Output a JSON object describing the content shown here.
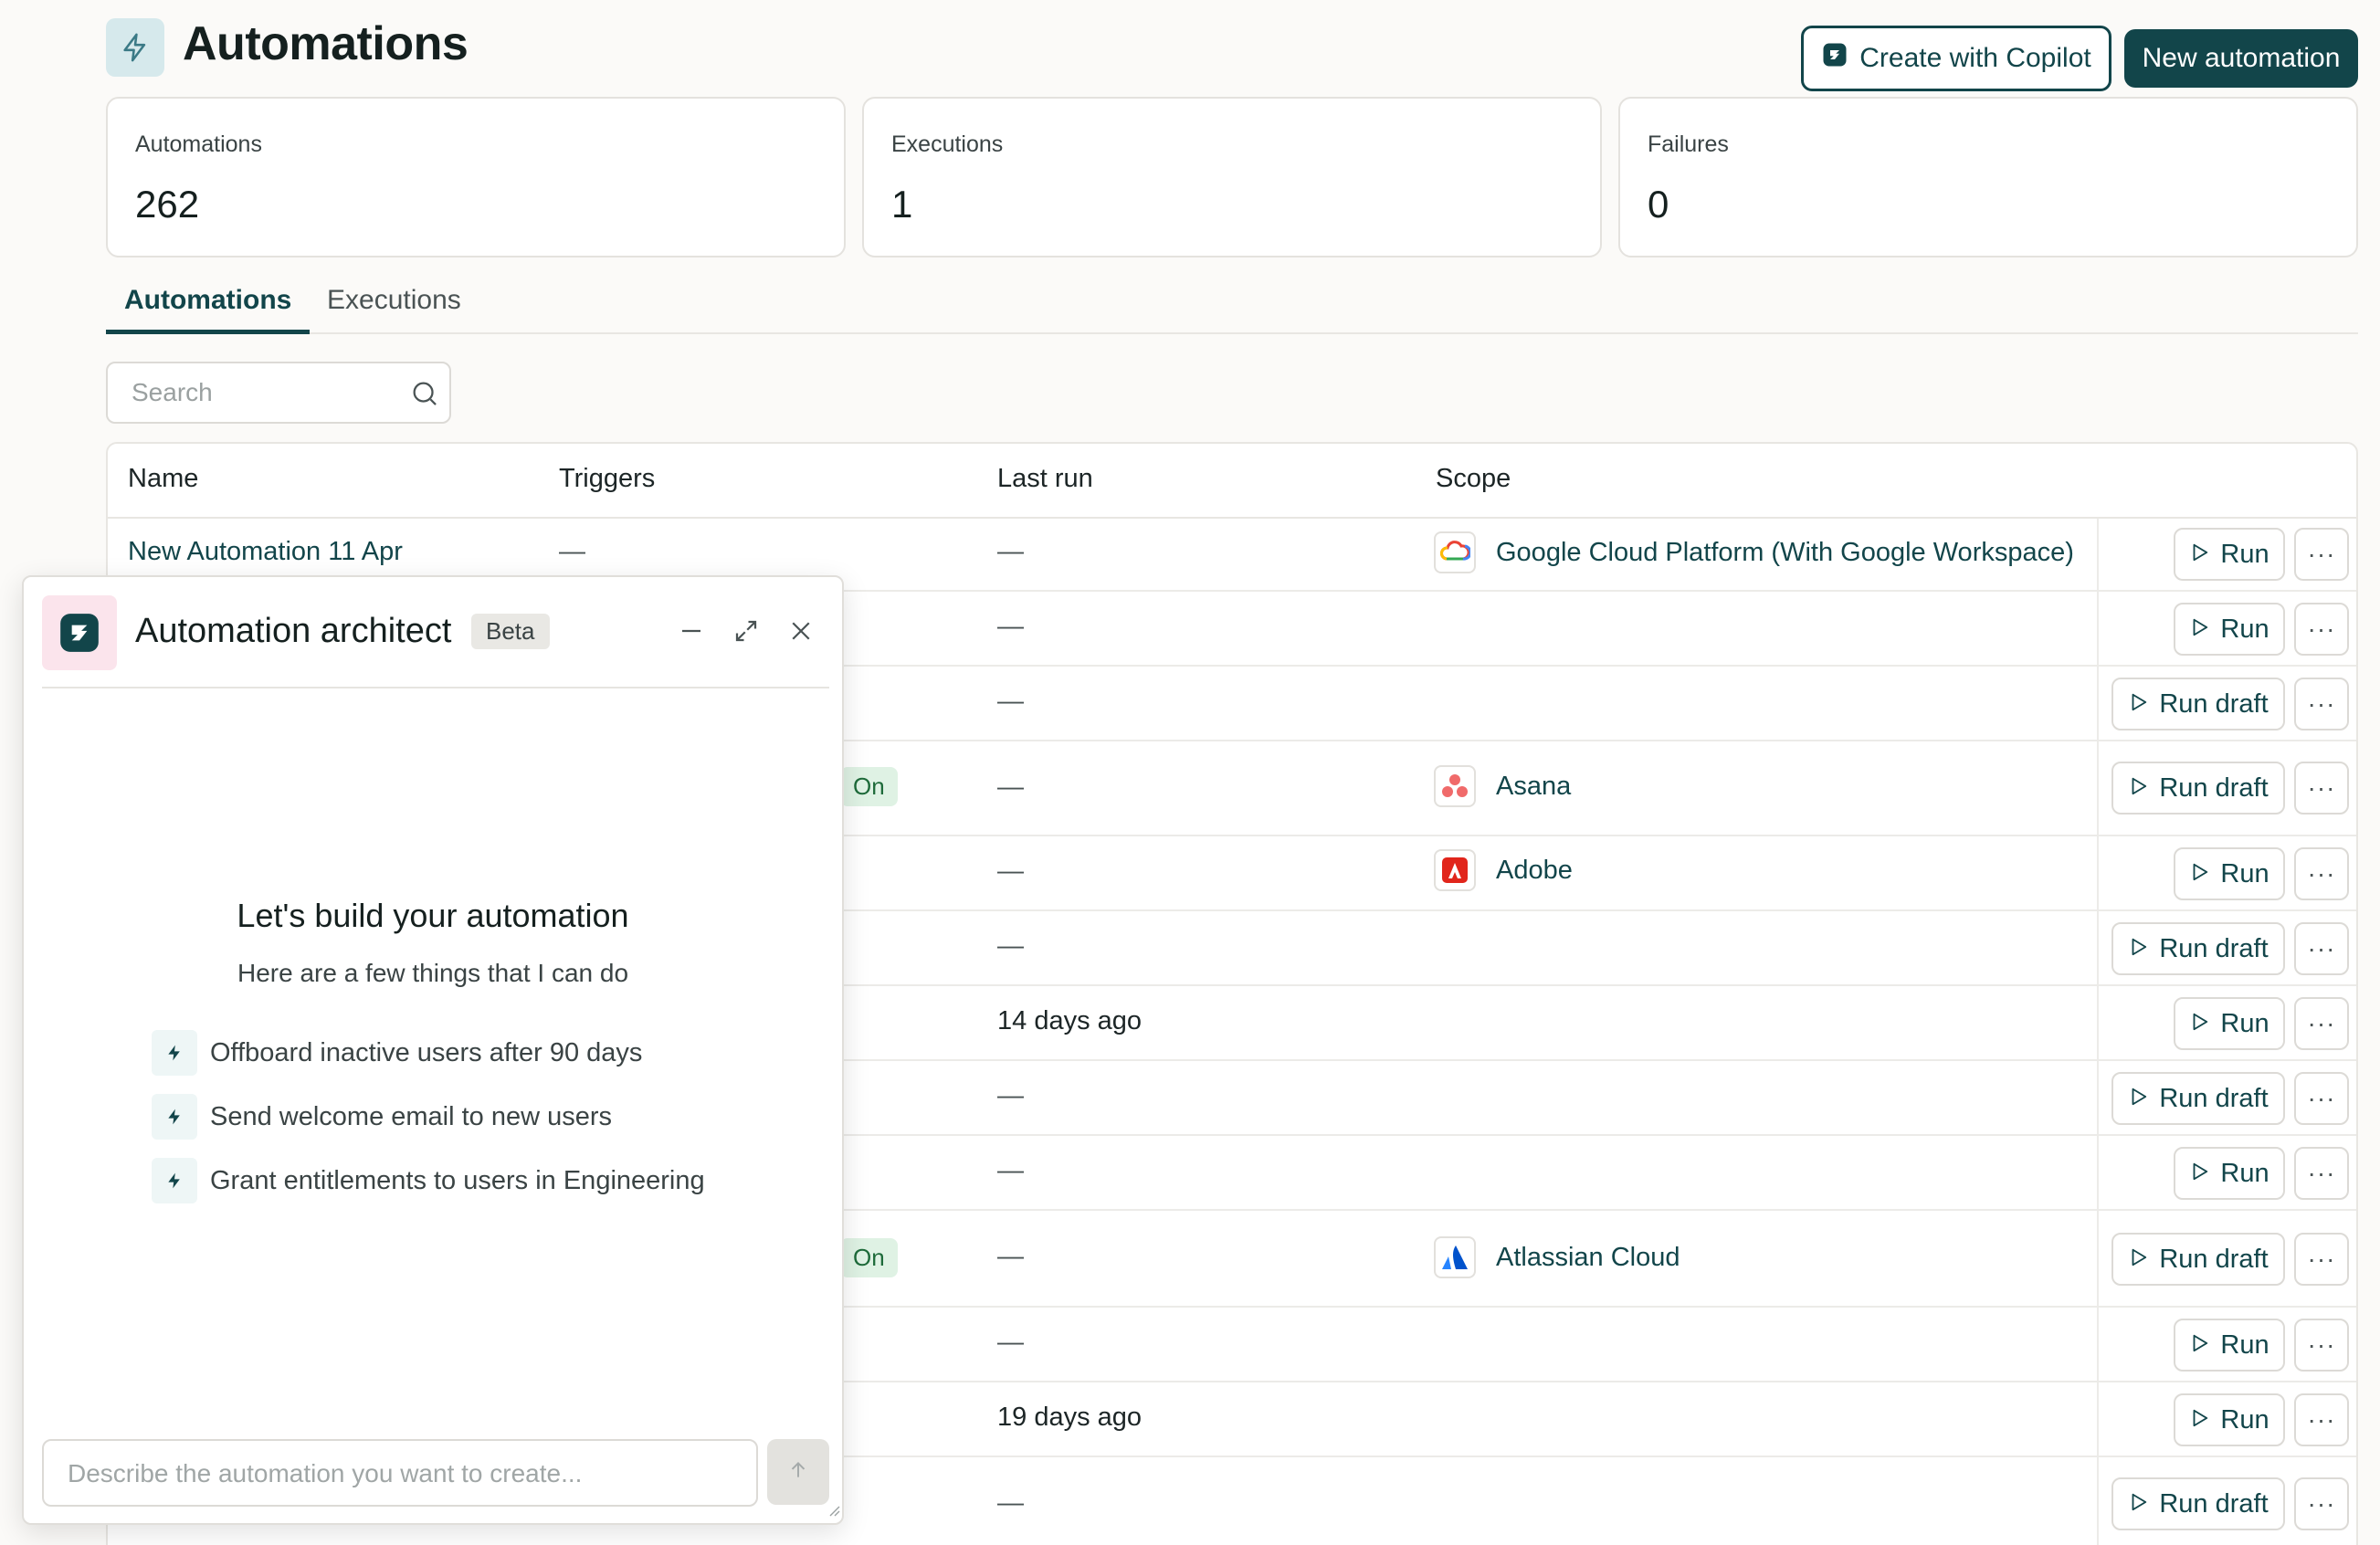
{
  "header": {
    "title": "Automations",
    "copilot_button": "Create with Copilot",
    "new_button": "New automation"
  },
  "stats": [
    {
      "label": "Automations",
      "value": "262"
    },
    {
      "label": "Executions",
      "value": "1"
    },
    {
      "label": "Failures",
      "value": "0"
    }
  ],
  "tabs": [
    {
      "label": "Automations",
      "active": true
    },
    {
      "label": "Executions",
      "active": false
    }
  ],
  "search": {
    "placeholder": "Search"
  },
  "table": {
    "columns": [
      "Name",
      "Triggers",
      "Last run",
      "Scope"
    ],
    "rows": [
      {
        "name": "New Automation 11 Apr",
        "triggers": "—",
        "last_run": "—",
        "scope": "Google Cloud Platform (With Google Workspace)",
        "scope_icon": "google-cloud-logo",
        "action": "Run"
      },
      {
        "name": "",
        "triggers": "",
        "last_run": "—",
        "scope": "",
        "action": "Run"
      },
      {
        "name": "",
        "triggers": "",
        "last_run": "—",
        "scope": "",
        "action": "Run draft"
      },
      {
        "name": "",
        "triggers": "On",
        "last_run": "—",
        "scope": "Asana",
        "scope_icon": "asana-logo",
        "action": "Run draft"
      },
      {
        "name": "",
        "triggers": "",
        "last_run": "—",
        "scope": "Adobe",
        "scope_icon": "adobe-logo",
        "action": "Run"
      },
      {
        "name": "",
        "triggers": "",
        "last_run": "—",
        "scope": "",
        "action": "Run draft"
      },
      {
        "name": "",
        "triggers": "",
        "last_run": "14 days ago",
        "scope": "",
        "action": "Run"
      },
      {
        "name": "",
        "triggers": "",
        "last_run": "—",
        "scope": "",
        "action": "Run draft"
      },
      {
        "name": "",
        "triggers": "",
        "last_run": "—",
        "scope": "",
        "action": "Run"
      },
      {
        "name": "",
        "triggers": "On",
        "last_run": "—",
        "scope": "Atlassian Cloud",
        "scope_icon": "atlassian-logo",
        "action": "Run draft"
      },
      {
        "name": "",
        "triggers": "",
        "last_run": "—",
        "scope": "",
        "action": "Run"
      },
      {
        "name": "",
        "triggers": "",
        "last_run": "19 days ago",
        "scope": "",
        "action": "Run"
      },
      {
        "name": "",
        "triggers": "",
        "last_run": "—",
        "scope": "",
        "action": "Run draft"
      }
    ],
    "more_label": "···"
  },
  "panel": {
    "title": "Automation architect",
    "badge": "Beta",
    "heading": "Let's build your automation",
    "subheading": "Here are a few things that I can do",
    "suggestions": [
      "Offboard inactive users after 90 days",
      "Send welcome email to new users",
      "Grant entitlements to users in Engineering"
    ],
    "input_placeholder": "Describe the automation you want to create..."
  },
  "colors": {
    "accent": "#12454a",
    "background": "#fbfaf8",
    "on_badge_bg": "#dff2e4"
  }
}
